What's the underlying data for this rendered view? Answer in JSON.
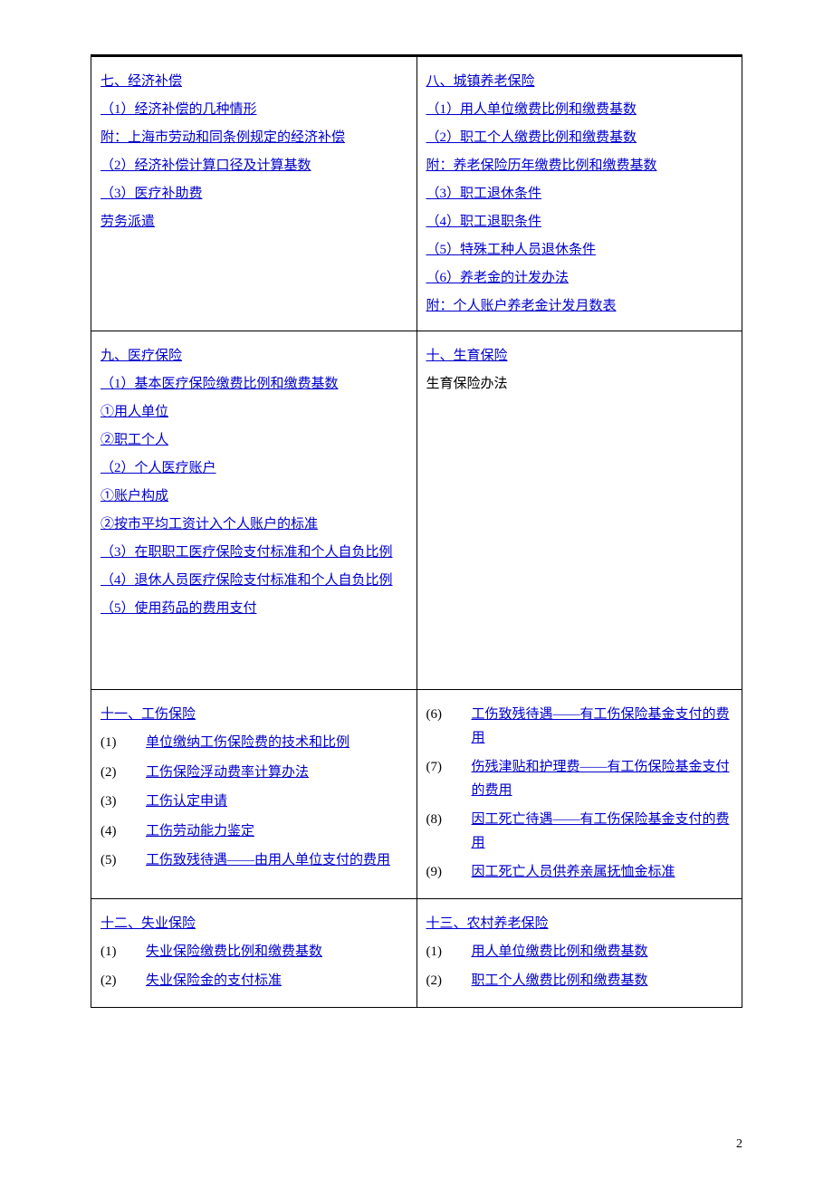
{
  "pageNumber": "2",
  "sections": {
    "s7": {
      "title": "七、经济补偿",
      "items": [
        {
          "text": "（1）经济补偿的几种情形",
          "link": true
        },
        {
          "text": "附：上海市劳动和同条例规定的经济补偿",
          "link": true
        },
        {
          "text": "（2）经济补偿计算口径及计算基数",
          "link": true
        },
        {
          "text": "（3）医疗补助费",
          "link": true
        },
        {
          "text": "劳务派遣",
          "link": true
        }
      ]
    },
    "s8": {
      "title": "八、城镇养老保险",
      "items": [
        {
          "text": "（1）用人单位缴费比例和缴费基数",
          "link": true
        },
        {
          "text": "（2）职工个人缴费比例和缴费基数",
          "link": true
        },
        {
          "text": "附：养老保险历年缴费比例和缴费基数",
          "link": true
        },
        {
          "text": "（3）职工退休条件",
          "link": true
        },
        {
          "text": "（4）职工退职条件",
          "link": true
        },
        {
          "text": "（5）特殊工种人员退休条件",
          "link": true
        },
        {
          "text": "（6）养老金的计发办法",
          "link": true
        },
        {
          "text": "附：个人账户养老金计发月数表",
          "link": true
        }
      ]
    },
    "s9": {
      "title": "九、医疗保险",
      "items": [
        {
          "text": "（1）基本医疗保险缴费比例和缴费基数",
          "link": true
        },
        {
          "text": "①用人单位",
          "link": true
        },
        {
          "text": "②职工个人",
          "link": true
        },
        {
          "text": "（2）个人医疗账户",
          "link": true
        },
        {
          "text": "①账户构成",
          "link": true
        },
        {
          "text": "②按市平均工资计入个人账户的标准",
          "link": true
        },
        {
          "text": "（3）在职职工医疗保险支付标准和个人自负比例",
          "link": true
        },
        {
          "text": "（4）退休人员医疗保险支付标准和个人自负比例",
          "link": true
        },
        {
          "text": "（5）使用药品的费用支付",
          "link": true
        }
      ]
    },
    "s10": {
      "title": "十、生育保险",
      "items": [
        {
          "text": "生育保险办法",
          "link": false
        }
      ]
    },
    "s11": {
      "title": "十一、工伤保险",
      "numbered": [
        {
          "num": "(1)",
          "text": "单位缴纳工伤保险费的技术和比例"
        },
        {
          "num": "(2)",
          "text": "工伤保险浮动费率计算办法"
        },
        {
          "num": "(3)",
          "text": "工伤认定申请"
        },
        {
          "num": "(4)",
          "text": "工伤劳动能力鉴定"
        },
        {
          "num": "(5)",
          "text": "工伤致残待遇——由用人单位支付的费用"
        }
      ]
    },
    "s11b": {
      "numbered": [
        {
          "num": "(6)",
          "text": "工伤致残待遇——有工伤保险基金支付的费用"
        },
        {
          "num": "(7)",
          "text": "伤残津贴和护理费——有工伤保险基金支付的费用"
        },
        {
          "num": "(8)",
          "text": "因工死亡待遇——有工伤保险基金支付的费用"
        },
        {
          "num": "(9)",
          "text": "因工死亡人员供养亲属抚恤金标准"
        }
      ]
    },
    "s12": {
      "title": "十二、失业保险",
      "numbered": [
        {
          "num": "(1)",
          "text": "失业保险缴费比例和缴费基数"
        },
        {
          "num": "(2)",
          "text": "失业保险金的支付标准"
        }
      ]
    },
    "s13": {
      "title": "十三、农村养老保险",
      "numbered": [
        {
          "num": "(1)",
          "text": "用人单位缴费比例和缴费基数"
        },
        {
          "num": "(2)",
          "text": "职工个人缴费比例和缴费基数"
        }
      ]
    }
  }
}
